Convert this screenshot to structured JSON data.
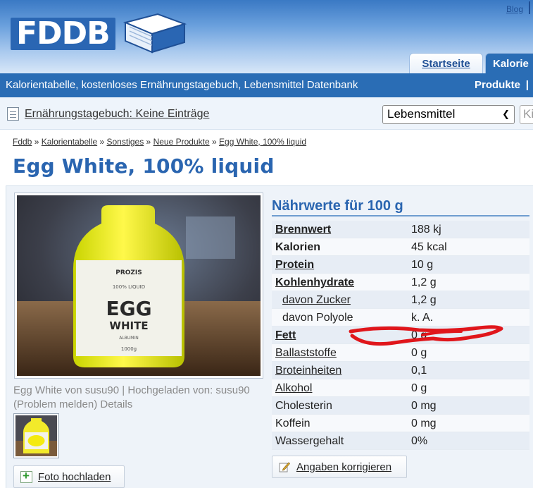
{
  "header": {
    "blog_label": "Blog",
    "logo_text": "FDDB",
    "tabs": [
      {
        "label": "Startseite"
      },
      {
        "label": "Kalorie"
      }
    ]
  },
  "nav": {
    "tagline": "Kalorientabelle, kostenloses Ernährungstagebuch, Lebensmittel Datenbank",
    "produkte_label": "Produkte",
    "separator": "|"
  },
  "diary": {
    "link_label": "Ernährungstagebuch: Keine Einträge",
    "select_value": "Lebensmittel",
    "search_placeholder": "Ki"
  },
  "breadcrumb": {
    "items": [
      "Fddb",
      "Kalorientabelle",
      "Sonstiges",
      "Neue Produkte",
      "Egg White, 100% liquid"
    ],
    "separator": "»"
  },
  "page_title": "Egg White, 100% liquid",
  "photo": {
    "bottle_brand": "PROZIS",
    "bottle_sub": "100% LIQUID",
    "bottle_word1": "EGG",
    "bottle_word2": "WHITE",
    "bottle_albumin": "ALBUMIN",
    "bottle_size": "1000g",
    "caption": "Egg White von susu90 | Hochgeladen von: susu90 (Problem melden) Details",
    "upload_label": "Foto hochladen"
  },
  "nutrition": {
    "heading": "Nährwerte für 100 g",
    "rows": [
      {
        "label": "Brennwert",
        "value": "188 kj"
      },
      {
        "label": "Kalorien",
        "value": "45 kcal"
      },
      {
        "label": "Protein",
        "value": "10 g"
      },
      {
        "label": "Kohlenhydrate",
        "value": "1,2 g"
      },
      {
        "label": "davon Zucker",
        "value": "1,2 g"
      },
      {
        "label": "davon Polyole",
        "value": "k. A."
      },
      {
        "label": "Fett",
        "value": "0 g"
      },
      {
        "label": "Ballaststoffe",
        "value": "0 g"
      },
      {
        "label": "Broteinheiten",
        "value": "0,1"
      },
      {
        "label": "Alkohol",
        "value": "0 g"
      },
      {
        "label": "Cholesterin",
        "value": "0 mg"
      },
      {
        "label": "Koffein",
        "value": "0 mg"
      },
      {
        "label": "Wassergehalt",
        "value": "0%"
      }
    ],
    "correct_label": "Angaben korrigieren"
  },
  "colors": {
    "brand_blue": "#2a6db5",
    "title_blue": "#2a65b0",
    "annotation_red": "#e0161b"
  }
}
